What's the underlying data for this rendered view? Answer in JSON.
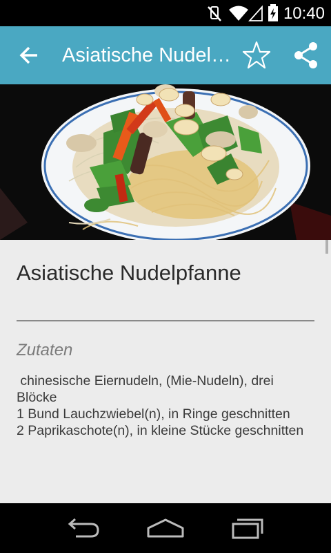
{
  "status_bar": {
    "time": "10:40",
    "icons": [
      "vibrate-muted-icon",
      "wifi-icon",
      "signal-icon",
      "battery-charging-icon"
    ]
  },
  "action_bar": {
    "title": "Asiatische Nudelpfanne",
    "back_icon": "back-arrow-icon",
    "favorite_icon": "star-outline-icon",
    "share_icon": "share-icon",
    "color": "#4aa8c2"
  },
  "recipe": {
    "title": "Asiatische Nudelpfanne",
    "ingredients_heading": "Zutaten",
    "ingredients": [
      " chinesische Eiernudeln, (Mie-Nudeln), drei Blöcke",
      "1 Bund Lauchzwiebel(n), in Ringe geschnitten",
      "2 Paprikaschote(n), in kleine Stücke geschnitten"
    ]
  },
  "nav_bar": {
    "icons": [
      "back-icon",
      "home-icon",
      "recent-apps-icon"
    ]
  }
}
